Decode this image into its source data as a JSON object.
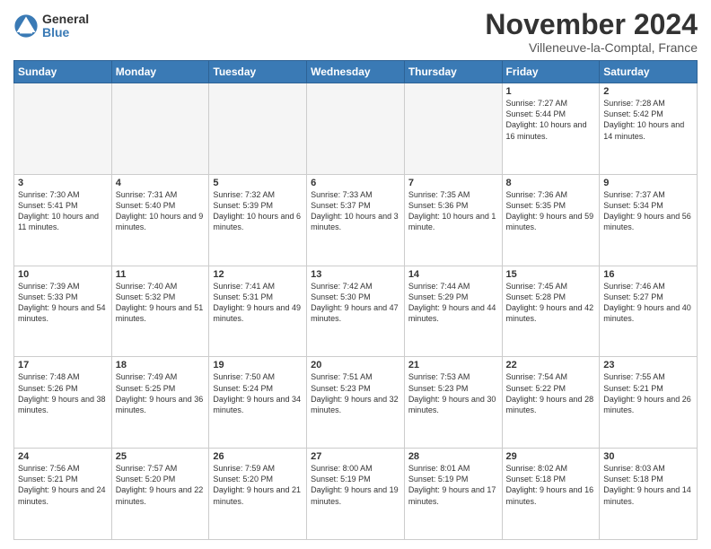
{
  "logo": {
    "general": "General",
    "blue": "Blue"
  },
  "title": "November 2024",
  "location": "Villeneuve-la-Comptal, France",
  "weekdays": [
    "Sunday",
    "Monday",
    "Tuesday",
    "Wednesday",
    "Thursday",
    "Friday",
    "Saturday"
  ],
  "weeks": [
    [
      {
        "day": "",
        "info": ""
      },
      {
        "day": "",
        "info": ""
      },
      {
        "day": "",
        "info": ""
      },
      {
        "day": "",
        "info": ""
      },
      {
        "day": "",
        "info": ""
      },
      {
        "day": "1",
        "info": "Sunrise: 7:27 AM\nSunset: 5:44 PM\nDaylight: 10 hours and 16 minutes."
      },
      {
        "day": "2",
        "info": "Sunrise: 7:28 AM\nSunset: 5:42 PM\nDaylight: 10 hours and 14 minutes."
      }
    ],
    [
      {
        "day": "3",
        "info": "Sunrise: 7:30 AM\nSunset: 5:41 PM\nDaylight: 10 hours and 11 minutes."
      },
      {
        "day": "4",
        "info": "Sunrise: 7:31 AM\nSunset: 5:40 PM\nDaylight: 10 hours and 9 minutes."
      },
      {
        "day": "5",
        "info": "Sunrise: 7:32 AM\nSunset: 5:39 PM\nDaylight: 10 hours and 6 minutes."
      },
      {
        "day": "6",
        "info": "Sunrise: 7:33 AM\nSunset: 5:37 PM\nDaylight: 10 hours and 3 minutes."
      },
      {
        "day": "7",
        "info": "Sunrise: 7:35 AM\nSunset: 5:36 PM\nDaylight: 10 hours and 1 minute."
      },
      {
        "day": "8",
        "info": "Sunrise: 7:36 AM\nSunset: 5:35 PM\nDaylight: 9 hours and 59 minutes."
      },
      {
        "day": "9",
        "info": "Sunrise: 7:37 AM\nSunset: 5:34 PM\nDaylight: 9 hours and 56 minutes."
      }
    ],
    [
      {
        "day": "10",
        "info": "Sunrise: 7:39 AM\nSunset: 5:33 PM\nDaylight: 9 hours and 54 minutes."
      },
      {
        "day": "11",
        "info": "Sunrise: 7:40 AM\nSunset: 5:32 PM\nDaylight: 9 hours and 51 minutes."
      },
      {
        "day": "12",
        "info": "Sunrise: 7:41 AM\nSunset: 5:31 PM\nDaylight: 9 hours and 49 minutes."
      },
      {
        "day": "13",
        "info": "Sunrise: 7:42 AM\nSunset: 5:30 PM\nDaylight: 9 hours and 47 minutes."
      },
      {
        "day": "14",
        "info": "Sunrise: 7:44 AM\nSunset: 5:29 PM\nDaylight: 9 hours and 44 minutes."
      },
      {
        "day": "15",
        "info": "Sunrise: 7:45 AM\nSunset: 5:28 PM\nDaylight: 9 hours and 42 minutes."
      },
      {
        "day": "16",
        "info": "Sunrise: 7:46 AM\nSunset: 5:27 PM\nDaylight: 9 hours and 40 minutes."
      }
    ],
    [
      {
        "day": "17",
        "info": "Sunrise: 7:48 AM\nSunset: 5:26 PM\nDaylight: 9 hours and 38 minutes."
      },
      {
        "day": "18",
        "info": "Sunrise: 7:49 AM\nSunset: 5:25 PM\nDaylight: 9 hours and 36 minutes."
      },
      {
        "day": "19",
        "info": "Sunrise: 7:50 AM\nSunset: 5:24 PM\nDaylight: 9 hours and 34 minutes."
      },
      {
        "day": "20",
        "info": "Sunrise: 7:51 AM\nSunset: 5:23 PM\nDaylight: 9 hours and 32 minutes."
      },
      {
        "day": "21",
        "info": "Sunrise: 7:53 AM\nSunset: 5:23 PM\nDaylight: 9 hours and 30 minutes."
      },
      {
        "day": "22",
        "info": "Sunrise: 7:54 AM\nSunset: 5:22 PM\nDaylight: 9 hours and 28 minutes."
      },
      {
        "day": "23",
        "info": "Sunrise: 7:55 AM\nSunset: 5:21 PM\nDaylight: 9 hours and 26 minutes."
      }
    ],
    [
      {
        "day": "24",
        "info": "Sunrise: 7:56 AM\nSunset: 5:21 PM\nDaylight: 9 hours and 24 minutes."
      },
      {
        "day": "25",
        "info": "Sunrise: 7:57 AM\nSunset: 5:20 PM\nDaylight: 9 hours and 22 minutes."
      },
      {
        "day": "26",
        "info": "Sunrise: 7:59 AM\nSunset: 5:20 PM\nDaylight: 9 hours and 21 minutes."
      },
      {
        "day": "27",
        "info": "Sunrise: 8:00 AM\nSunset: 5:19 PM\nDaylight: 9 hours and 19 minutes."
      },
      {
        "day": "28",
        "info": "Sunrise: 8:01 AM\nSunset: 5:19 PM\nDaylight: 9 hours and 17 minutes."
      },
      {
        "day": "29",
        "info": "Sunrise: 8:02 AM\nSunset: 5:18 PM\nDaylight: 9 hours and 16 minutes."
      },
      {
        "day": "30",
        "info": "Sunrise: 8:03 AM\nSunset: 5:18 PM\nDaylight: 9 hours and 14 minutes."
      }
    ]
  ]
}
